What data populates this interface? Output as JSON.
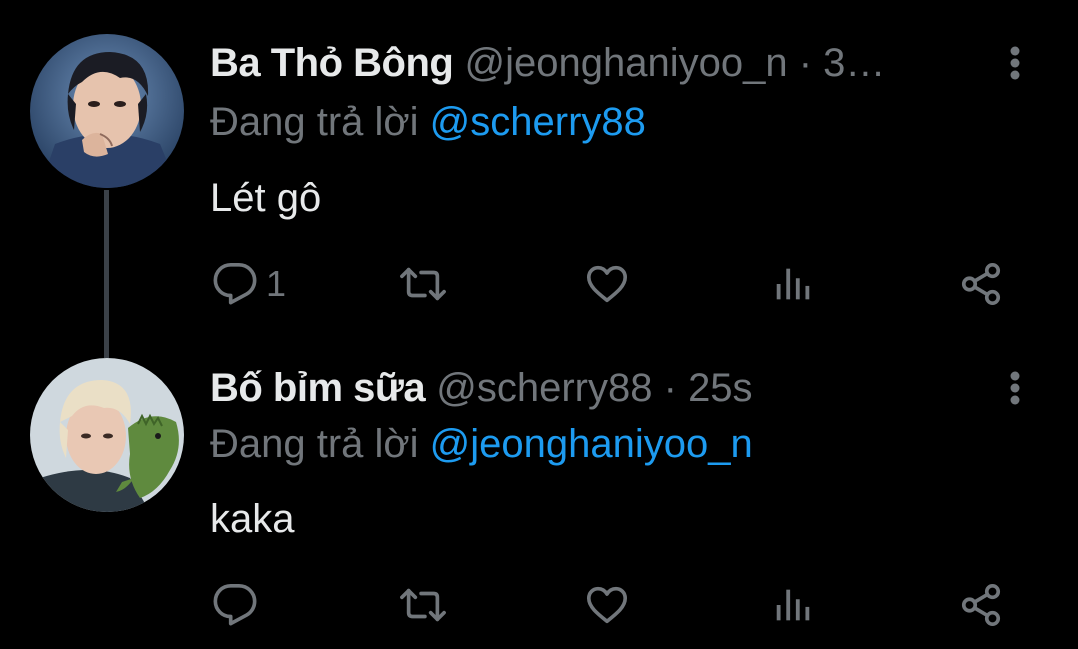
{
  "colors": {
    "background": "#000000",
    "primary_text": "#e7e9ea",
    "secondary_text": "#71767b",
    "link": "#1d9bf0",
    "thread_line": "#3b4148"
  },
  "tweets": [
    {
      "display_name": "Ba Thỏ Bông",
      "handle": "@jeonghaniyoo_n",
      "separator": "·",
      "time": "3…",
      "reply_prefix": "Đang trả lời",
      "reply_to": "@scherry88",
      "text": "Lét gô",
      "reply_count": "1",
      "icons": [
        "reply-icon",
        "retweet-icon",
        "like-icon",
        "views-icon",
        "share-icon",
        "more-vertical-icon"
      ]
    },
    {
      "display_name": "Bố bỉm sữa",
      "handle": "@scherry88",
      "separator": "·",
      "time": "25s",
      "reply_prefix": "Đang trả lời",
      "reply_to": "@jeonghaniyoo_n",
      "text": "kaka",
      "reply_count": "",
      "icons": [
        "reply-icon",
        "retweet-icon",
        "like-icon",
        "views-icon",
        "share-icon",
        "more-vertical-icon"
      ]
    }
  ]
}
